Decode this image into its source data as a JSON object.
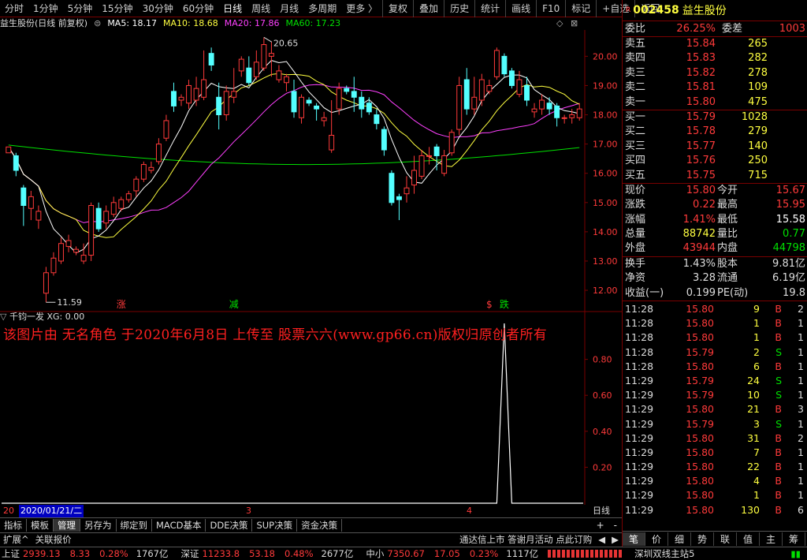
{
  "toolbar": {
    "items": [
      "分时",
      "1分钟",
      "5分钟",
      "15分钟",
      "30分钟",
      "60分钟",
      "日线",
      "周线",
      "月线",
      "多周期",
      "更多 〉"
    ],
    "active": 6,
    "right_items": [
      "复权",
      "叠加",
      "历史",
      "统计",
      "画线",
      "F10",
      "标记",
      "+自选",
      "返回"
    ]
  },
  "stock": {
    "code": "002458",
    "name": "益生股份",
    "marker": "R"
  },
  "info": {
    "title": "益生股份(日线 前复权)",
    "ma5": "MA5: 18.17",
    "ma10": "MA10: 18.68",
    "ma20": "MA20: 17.86",
    "ma60": "MA60: 17.23"
  },
  "chart_data": {
    "type": "candlestick",
    "ylim": [
      11.3,
      20.9
    ],
    "yticks": [
      "12.00",
      "13.00",
      "14.00",
      "15.00",
      "16.00",
      "17.00",
      "18.00",
      "19.00",
      "20.00"
    ],
    "high_label": "20.65",
    "low_label": "11.59",
    "candles": [
      [
        16.7,
        16.9,
        16.7,
        16.8
      ],
      [
        16.6,
        16.1,
        15.9,
        16.7
      ],
      [
        15.5,
        14.9,
        14.2,
        15.6
      ],
      [
        14.8,
        15.2,
        14.4,
        15.4
      ],
      [
        14.4,
        14.7,
        14.1,
        14.9
      ],
      [
        11.9,
        12.6,
        11.59,
        12.8
      ],
      [
        12.6,
        13.1,
        12.5,
        13.3
      ],
      [
        13.0,
        13.6,
        12.9,
        13.8
      ],
      [
        13.5,
        13.7,
        13.3,
        13.9
      ],
      [
        13.3,
        13.4,
        13.2,
        13.5
      ],
      [
        13.0,
        13.2,
        12.9,
        13.6
      ],
      [
        13.2,
        14.9,
        13.0,
        15.0
      ],
      [
        14.8,
        14.1,
        14.0,
        15.0
      ],
      [
        14.3,
        14.7,
        14.1,
        14.9
      ],
      [
        14.6,
        15.0,
        14.5,
        15.2
      ],
      [
        14.8,
        15.1,
        14.7,
        15.2
      ],
      [
        15.1,
        15.3,
        15.0,
        15.4
      ],
      [
        15.4,
        15.8,
        15.2,
        15.9
      ],
      [
        15.8,
        16.3,
        15.7,
        16.4
      ],
      [
        16.1,
        16.2,
        16.0,
        16.4
      ],
      [
        16.4,
        17.0,
        16.3,
        17.2
      ],
      [
        17.2,
        17.8,
        17.1,
        18.0
      ],
      [
        18.8,
        18.3,
        18.1,
        19.1
      ],
      [
        18.5,
        18.6,
        18.3,
        18.7
      ],
      [
        18.4,
        19.0,
        18.2,
        19.2
      ],
      [
        18.5,
        18.9,
        18.3,
        19.3
      ],
      [
        18.6,
        19.2,
        18.5,
        20.2
      ],
      [
        20.1,
        19.7,
        19.5,
        20.3
      ],
      [
        18.6,
        18.0,
        17.5,
        19.1
      ],
      [
        18.0,
        18.8,
        17.8,
        19.0
      ],
      [
        18.6,
        18.8,
        18.4,
        19.6
      ],
      [
        19.5,
        19.9,
        19.3,
        20.0
      ],
      [
        19.6,
        19.1,
        19.0,
        20.0
      ],
      [
        19.3,
        19.8,
        19.2,
        20.2
      ],
      [
        19.6,
        20.4,
        19.5,
        20.65
      ],
      [
        20.0,
        20.1,
        19.3,
        20.5
      ],
      [
        19.2,
        19.5,
        19.1,
        19.7
      ],
      [
        19.1,
        19.3,
        18.8,
        19.4
      ],
      [
        18.8,
        18.1,
        17.9,
        19.2
      ],
      [
        17.9,
        18.6,
        17.7,
        18.7
      ],
      [
        18.5,
        18.4,
        18.3,
        18.6
      ],
      [
        18.3,
        18.2,
        17.8,
        18.4
      ],
      [
        17.8,
        17.9,
        17.6,
        18.1
      ],
      [
        16.8,
        17.3,
        16.7,
        18.5
      ],
      [
        18.2,
        18.9,
        18.0,
        19.1
      ],
      [
        18.9,
        18.8,
        18.7,
        19.0
      ],
      [
        18.8,
        18.6,
        18.1,
        19.3
      ],
      [
        18.6,
        18.2,
        17.9,
        18.8
      ],
      [
        18.4,
        18.1,
        18.0,
        18.6
      ],
      [
        18.0,
        17.7,
        17.5,
        18.2
      ],
      [
        17.5,
        16.8,
        16.6,
        17.6
      ],
      [
        16.0,
        15.0,
        14.9,
        16.1
      ],
      [
        15.2,
        15.1,
        14.4,
        15.3
      ],
      [
        15.3,
        15.5,
        15.0,
        15.9
      ],
      [
        15.6,
        16.1,
        15.3,
        16.6
      ],
      [
        15.9,
        16.6,
        15.8,
        16.8
      ],
      [
        16.6,
        16.6,
        16.3,
        16.9
      ],
      [
        16.9,
        16.6,
        16.1,
        17.0
      ],
      [
        16.0,
        16.6,
        15.9,
        16.8
      ],
      [
        16.7,
        17.4,
        16.6,
        17.5
      ],
      [
        17.5,
        19.0,
        17.3,
        19.3
      ],
      [
        19.2,
        18.2,
        18.0,
        19.6
      ],
      [
        18.2,
        18.6,
        18.0,
        19.3
      ],
      [
        18.5,
        19.2,
        18.3,
        19.4
      ],
      [
        18.8,
        19.0,
        18.7,
        19.2
      ],
      [
        19.3,
        20.2,
        19.2,
        20.3
      ],
      [
        20.0,
        19.4,
        19.3,
        20.1
      ],
      [
        19.5,
        19.0,
        18.9,
        19.6
      ],
      [
        18.7,
        19.2,
        18.6,
        19.5
      ],
      [
        19.0,
        18.5,
        18.3,
        19.3
      ],
      [
        18.1,
        18.2,
        17.9,
        18.4
      ],
      [
        18.2,
        18.5,
        18.0,
        18.7
      ],
      [
        18.4,
        18.2,
        18.0,
        18.6
      ],
      [
        18.3,
        17.9,
        17.6,
        18.4
      ],
      [
        17.9,
        17.9,
        17.7,
        18.0
      ],
      [
        17.9,
        18.0,
        17.7,
        18.2
      ],
      [
        17.9,
        18.2,
        17.8,
        18.4
      ]
    ],
    "markers": [
      {
        "text": "涨",
        "index": 15,
        "color": "#ff3a3a"
      },
      {
        "text": "减",
        "index": 30,
        "color": "#00e000"
      },
      {
        "text": "$",
        "index": 64,
        "color": "#ff3a3a"
      },
      {
        "text": "跌",
        "index": 66,
        "color": "#00e000"
      }
    ]
  },
  "indicator": {
    "label": "千钧一发 XG: 0.00",
    "yticks": [
      "0.20",
      "0.40",
      "0.60",
      "0.80"
    ],
    "spike_index": 66,
    "spike_value": 1.0
  },
  "watermark": "该图片由 无名角色 于2020年6月8日 上传至 股票六六(www.gp66.cn)版权归原创者所有",
  "dates": {
    "first": "20",
    "selected": "2020/01/21/二",
    "m3": "3",
    "m4": "4",
    "period": "日线"
  },
  "tabs": [
    "指标",
    "模板",
    "管理",
    "另存为",
    "绑定到",
    "MACD基本",
    "DDE决策",
    "SUP决策",
    "资金决策"
  ],
  "tabs_active": 2,
  "bottom2": {
    "left": "扩展^",
    "left2": "关联报价",
    "right": "通达信上市 答谢月活动 点此订购"
  },
  "quote": {
    "weibi": {
      "label": "委比",
      "value": "26.25%",
      "label2": "委差",
      "value2": "1003"
    },
    "sell": [
      {
        "label": "卖五",
        "price": "15.84",
        "vol": "265"
      },
      {
        "label": "卖四",
        "price": "15.83",
        "vol": "282"
      },
      {
        "label": "卖三",
        "price": "15.82",
        "vol": "278"
      },
      {
        "label": "卖二",
        "price": "15.81",
        "vol": "109"
      },
      {
        "label": "卖一",
        "price": "15.80",
        "vol": "475"
      }
    ],
    "buy": [
      {
        "label": "买一",
        "price": "15.79",
        "vol": "1028"
      },
      {
        "label": "买二",
        "price": "15.78",
        "vol": "279"
      },
      {
        "label": "买三",
        "price": "15.77",
        "vol": "140"
      },
      {
        "label": "买四",
        "price": "15.76",
        "vol": "250"
      },
      {
        "label": "买五",
        "price": "15.75",
        "vol": "715"
      }
    ],
    "stats": [
      {
        "l1": "现价",
        "v1": "15.80",
        "c1": "red",
        "l2": "今开",
        "v2": "15.67",
        "c2": "red"
      },
      {
        "l1": "涨跌",
        "v1": "0.22",
        "c1": "red",
        "l2": "最高",
        "v2": "15.95",
        "c2": "red"
      },
      {
        "l1": "涨幅",
        "v1": "1.41%",
        "c1": "red",
        "l2": "最低",
        "v2": "15.58",
        "c2": "white"
      },
      {
        "l1": "总量",
        "v1": "88742",
        "c1": "yellow",
        "l2": "量比",
        "v2": "0.77",
        "c2": "green"
      },
      {
        "l1": "外盘",
        "v1": "43944",
        "c1": "red",
        "l2": "内盘",
        "v2": "44798",
        "c2": "green"
      }
    ],
    "stats2": [
      {
        "l1": "换手",
        "v1": "1.43%",
        "l2": "股本",
        "v2": "9.81亿"
      },
      {
        "l1": "净资",
        "v1": "3.28",
        "l2": "流通",
        "v2": "6.19亿"
      },
      {
        "l1": "收益(一)",
        "v1": "0.199",
        "l2": "PE(动)",
        "v2": "19.8"
      }
    ]
  },
  "ticks": [
    [
      "11:28",
      "15.80",
      "9",
      "B",
      "2"
    ],
    [
      "11:28",
      "15.80",
      "1",
      "B",
      "1"
    ],
    [
      "11:28",
      "15.80",
      "1",
      "B",
      "1"
    ],
    [
      "11:28",
      "15.79",
      "2",
      "S",
      "1"
    ],
    [
      "11:28",
      "15.80",
      "6",
      "B",
      "1"
    ],
    [
      "11:29",
      "15.79",
      "24",
      "S",
      "1"
    ],
    [
      "11:29",
      "15.79",
      "10",
      "S",
      "1"
    ],
    [
      "11:29",
      "15.80",
      "21",
      "B",
      "3"
    ],
    [
      "11:29",
      "15.79",
      "3",
      "S",
      "1"
    ],
    [
      "11:29",
      "15.80",
      "31",
      "B",
      "2"
    ],
    [
      "11:29",
      "15.80",
      "7",
      "B",
      "1"
    ],
    [
      "11:29",
      "15.80",
      "22",
      "B",
      "1"
    ],
    [
      "11:29",
      "15.80",
      "4",
      "B",
      "1"
    ],
    [
      "11:29",
      "15.80",
      "1",
      "B",
      "1"
    ],
    [
      "11:29",
      "15.80",
      "130",
      "B",
      "6"
    ]
  ],
  "right_tabs": [
    "笔",
    "价",
    "细",
    "势",
    "联",
    "值",
    "主",
    "筹"
  ],
  "status": {
    "sh_label": "上证",
    "sh": "2939.13",
    "sh_ch": "8.33",
    "sh_pct": "0.28%",
    "sh_amt": "1767亿",
    "sz_label": "深证",
    "sz": "11233.8",
    "sz_ch": "53.18",
    "sz_pct": "0.48%",
    "sz_amt": "2677亿",
    "zx_label": "中小",
    "zx": "7350.67",
    "zx_ch": "17.05",
    "zx_pct": "0.23%",
    "zx_amt": "1117亿",
    "server": "深圳双线主站5"
  },
  "colors": {
    "up": "#ff3a3a",
    "down": "#00e000",
    "candle_down": "#54ffff",
    "ma5": "#ffffff",
    "ma10": "#ffff40",
    "ma20": "#ff40ff",
    "ma60": "#00e000",
    "grid": "#7a0000"
  }
}
